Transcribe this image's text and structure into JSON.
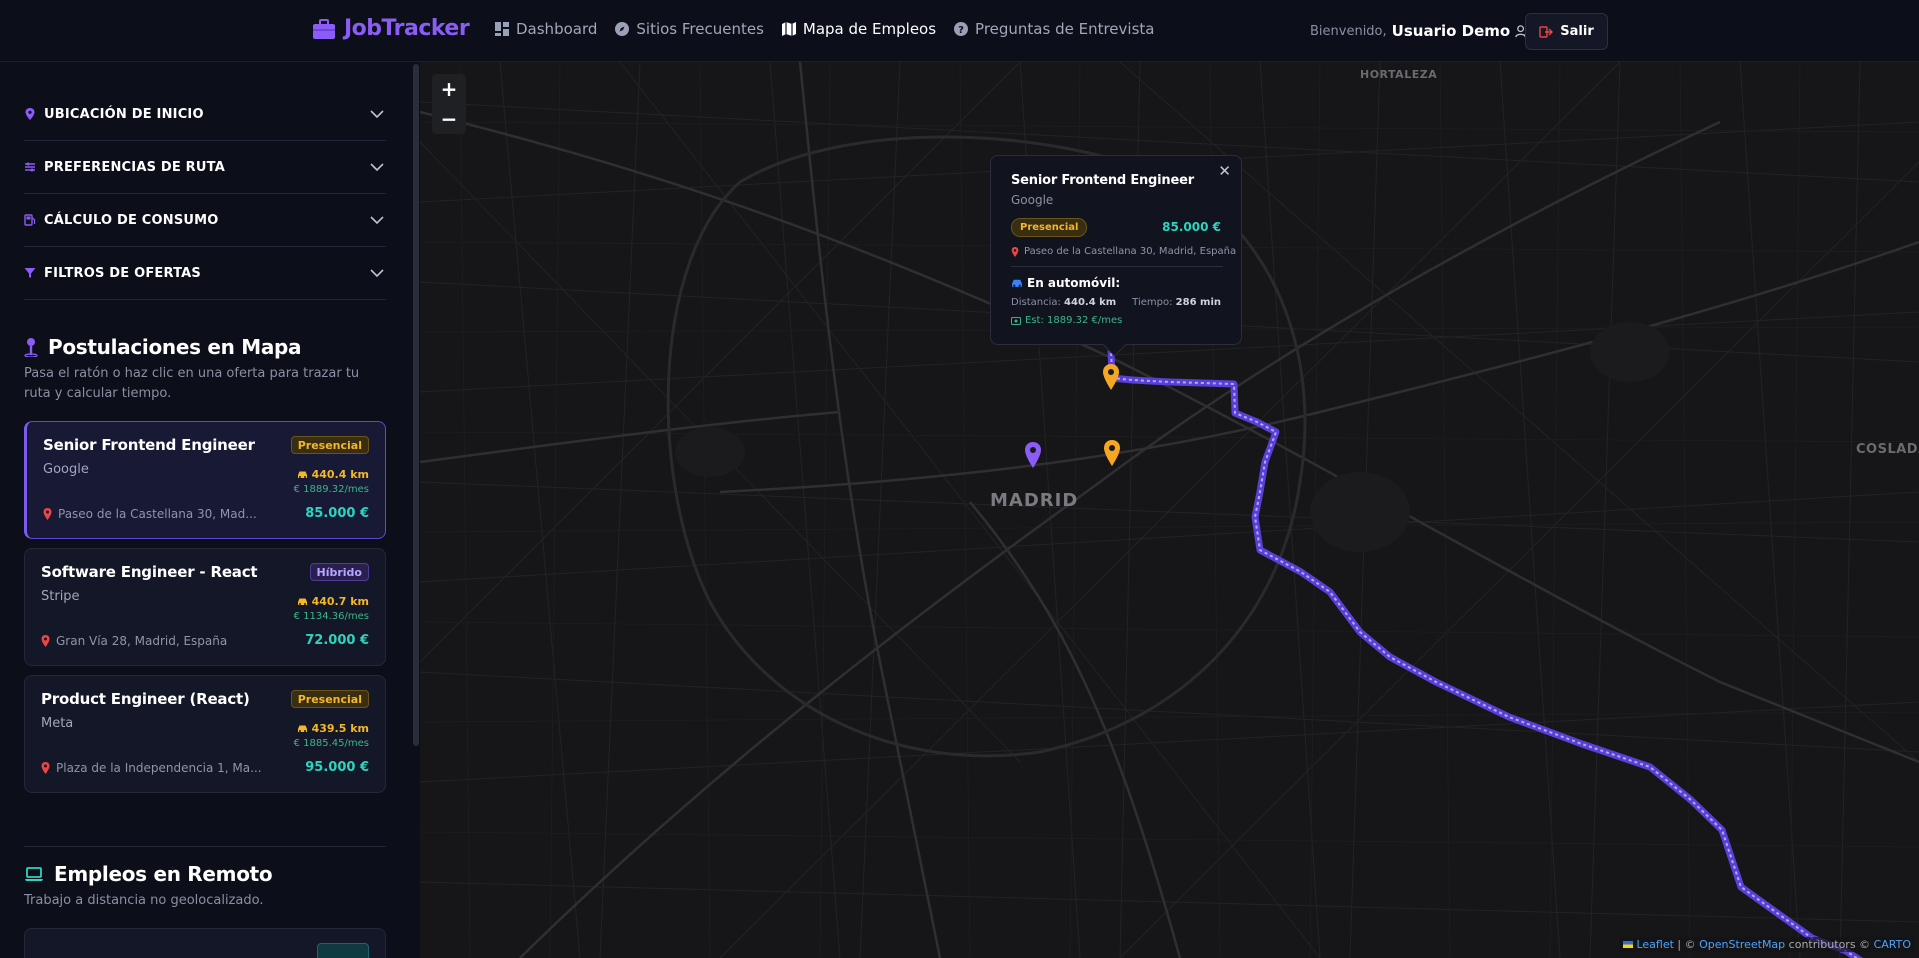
{
  "header": {
    "logo": "JobTracker",
    "nav": [
      {
        "label": "Dashboard",
        "icon": "dashboard-icon"
      },
      {
        "label": "Sitios Frecuentes",
        "icon": "compass-icon"
      },
      {
        "label": "Mapa de Empleos",
        "icon": "map-icon"
      },
      {
        "label": "Preguntas de Entrevista",
        "icon": "question-icon"
      }
    ],
    "welcome_prefix": "Bienvenido,",
    "user_name": "Usuario Demo",
    "logout_label": "Salir"
  },
  "sidebar": {
    "accordions": [
      {
        "label": "UBICACIÓN DE INICIO",
        "icon": "pin-icon"
      },
      {
        "label": "PREFERENCIAS DE RUTA",
        "icon": "route-icon"
      },
      {
        "label": "CÁLCULO DE CONSUMO",
        "icon": "fuel-icon"
      },
      {
        "label": "FILTROS DE OFERTAS",
        "icon": "filter-icon"
      }
    ],
    "map_section": {
      "title": "Postulaciones en Mapa",
      "subtitle": "Pasa el ratón o haz clic en una oferta para trazar tu ruta y calcular tiempo."
    },
    "jobs": [
      {
        "title": "Senior Frontend Engineer",
        "company": "Google",
        "badge": "Presencial",
        "km": "440.4 km",
        "cost": "€ 1889.32/mes",
        "address": "Paseo de la Castellana 30, Mad...",
        "salary": "85.000 €"
      },
      {
        "title": "Software Engineer - React",
        "company": "Stripe",
        "badge": "Híbrido",
        "km": "440.7 km",
        "cost": "€ 1134.36/mes",
        "address": "Gran Vía 28, Madrid, España",
        "salary": "72.000 €"
      },
      {
        "title": "Product Engineer (React)",
        "company": "Meta",
        "badge": "Presencial",
        "km": "439.5 km",
        "cost": "€ 1885.45/mes",
        "address": "Plaza de la Independencia 1, Ma...",
        "salary": "95.000 €"
      }
    ],
    "remote_section": {
      "title": "Empleos en Remoto",
      "subtitle": "Trabajo a distancia no geolocalizado."
    }
  },
  "map": {
    "zoom_in": "+",
    "zoom_out": "−",
    "places": {
      "madrid": "MADRID",
      "hortaleza": "HORTALEZA",
      "coslada": "COSLADA"
    },
    "attribution": {
      "leaflet": "Leaflet",
      "sep1": " | © ",
      "osm": "OpenStreetMap",
      "mid": " contributors © ",
      "carto": "CARTO"
    },
    "popup": {
      "title": "Senior Frontend Engineer",
      "company": "Google",
      "badge": "Presencial",
      "salary": "85.000 €",
      "address": "Paseo de la Castellana 30, Madrid, España",
      "mode": "En automóvil:",
      "distance_label": "Distancia:",
      "distance": "440.4 km",
      "time_label": "Tiempo:",
      "time": "286 min",
      "estimate": "Est: 1889.32 €/mes"
    }
  },
  "colors": {
    "accent": "#8b5cf6",
    "route": "#6d4ae0",
    "marker_orange": "#f5a623",
    "marker_purple": "#8b5cf6",
    "salary": "#2dd4bf"
  }
}
